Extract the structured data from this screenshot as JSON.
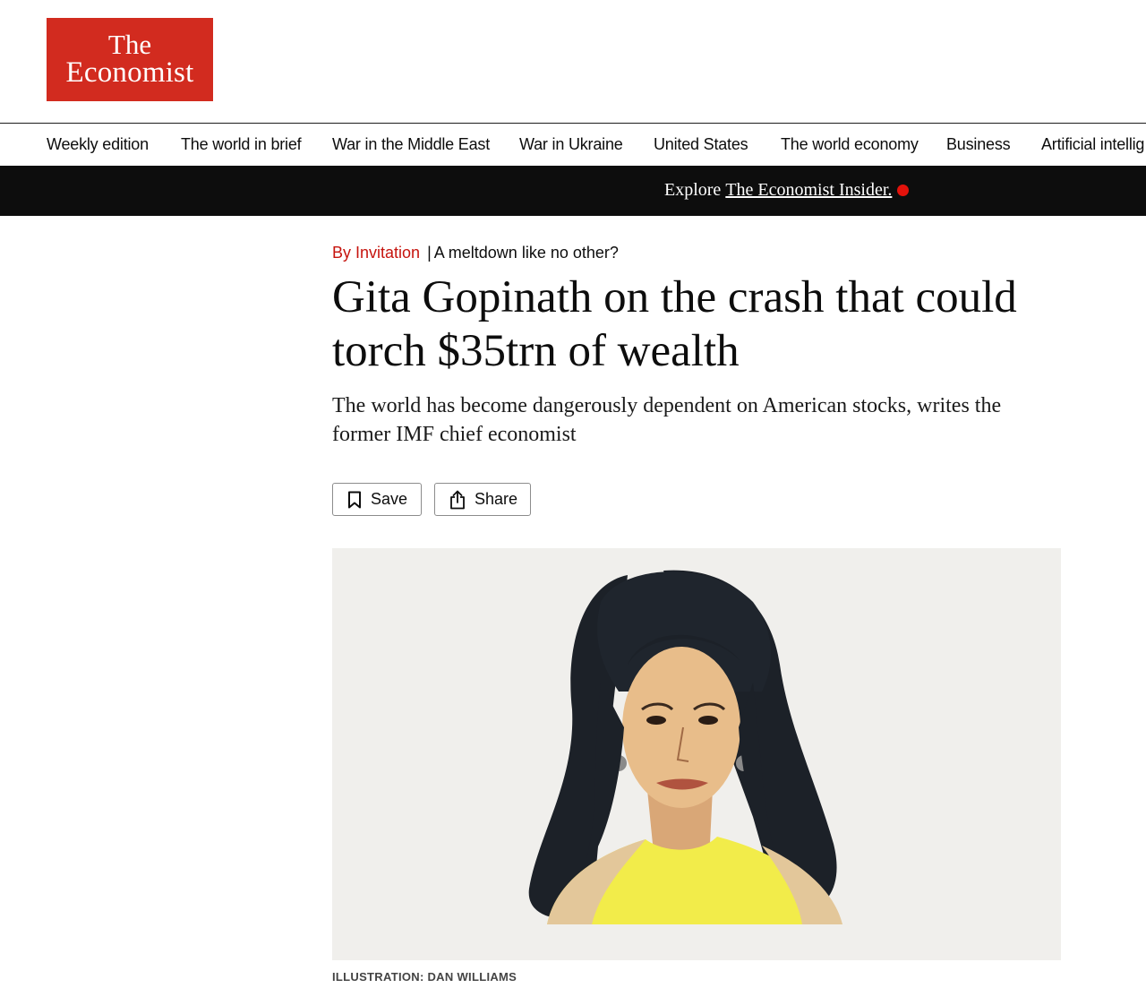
{
  "header": {
    "logo_line1": "The",
    "logo_line2": "Economist",
    "logo_color": "#d22b1f"
  },
  "nav": {
    "items": [
      "Weekly edition",
      "The world in brief",
      "War in the Middle East",
      "War in Ukraine",
      "United States",
      "The world economy",
      "Business",
      "Artificial intellig"
    ]
  },
  "banner": {
    "prefix": "Explore",
    "link": "The Economist Insider.",
    "dot_color": "#e3120b"
  },
  "article": {
    "section": "By Invitation",
    "separator": "|",
    "rubric": "A meltdown like no other?",
    "headline": "Gita Gopinath on the crash that could torch $35trn of wealth",
    "standfirst": "The world has become dangerously dependent on American stocks, writes the former IMF chief economist",
    "caption": "ILLUSTRATION: DAN WILLIAMS"
  },
  "actions": {
    "save_label": "Save",
    "share_label": "Share",
    "save_icon": "bookmark-icon",
    "share_icon": "share-icon"
  }
}
